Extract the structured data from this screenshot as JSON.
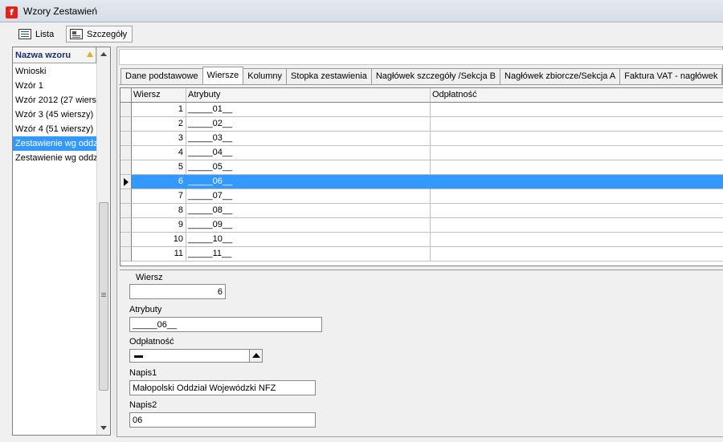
{
  "window": {
    "title": "Wzory Zestawień",
    "icon": "app-logo-icon"
  },
  "toolbar": {
    "list_label": "Lista",
    "details_label": "Szczegóły"
  },
  "left_list": {
    "header": "Nazwa wzoru",
    "items": [
      "Wnioski",
      "Wzór 1",
      "Wzór 2012 (27 wiersz",
      "Wzór 3 (45 wierszy)",
      "Wzór 4 (51 wierszy)",
      "Zestawienie wg oddz",
      "Zestawienie wg oddz"
    ],
    "selected_index": 5
  },
  "tabs": [
    "Dane podstawowe",
    "Wiersze",
    "Kolumny",
    "Stopka zestawienia",
    "Nagłówek szczegóły /Sekcja B",
    "Nagłówek zbiorcze/Sekcja A",
    "Faktura VAT - nagłówek"
  ],
  "active_tab": 1,
  "grid": {
    "columns": [
      "Wiersz",
      "Atrybuty",
      "Odpłatność"
    ],
    "rows": [
      {
        "wiersz": "1",
        "atrybuty": "_____01__",
        "odplatnosc": ""
      },
      {
        "wiersz": "2",
        "atrybuty": "_____02__",
        "odplatnosc": ""
      },
      {
        "wiersz": "3",
        "atrybuty": "_____03__",
        "odplatnosc": ""
      },
      {
        "wiersz": "4",
        "atrybuty": "_____04__",
        "odplatnosc": ""
      },
      {
        "wiersz": "5",
        "atrybuty": "_____05__",
        "odplatnosc": ""
      },
      {
        "wiersz": "6",
        "atrybuty": "_____06__",
        "odplatnosc": ""
      },
      {
        "wiersz": "7",
        "atrybuty": "_____07__",
        "odplatnosc": ""
      },
      {
        "wiersz": "8",
        "atrybuty": "_____08__",
        "odplatnosc": ""
      },
      {
        "wiersz": "9",
        "atrybuty": "_____09__",
        "odplatnosc": ""
      },
      {
        "wiersz": "10",
        "atrybuty": "_____10__",
        "odplatnosc": ""
      },
      {
        "wiersz": "11",
        "atrybuty": "_____11__",
        "odplatnosc": ""
      }
    ],
    "selected_index": 5
  },
  "form": {
    "wiersz_label": "Wiersz",
    "wiersz_value": "6",
    "atrybuty_label": "Atrybuty",
    "atrybuty_value": "_____06__",
    "odplatnosc_label": "Odpłatność",
    "napis1_label": "Napis1",
    "napis1_value": "Małopolski Oddział Wojewódzki NFZ",
    "napis2_label": "Napis2",
    "napis2_value": "06"
  },
  "colors": {
    "selection": "#3399ff",
    "header_text": "#1a2e6e",
    "logo": "#e8201a"
  }
}
